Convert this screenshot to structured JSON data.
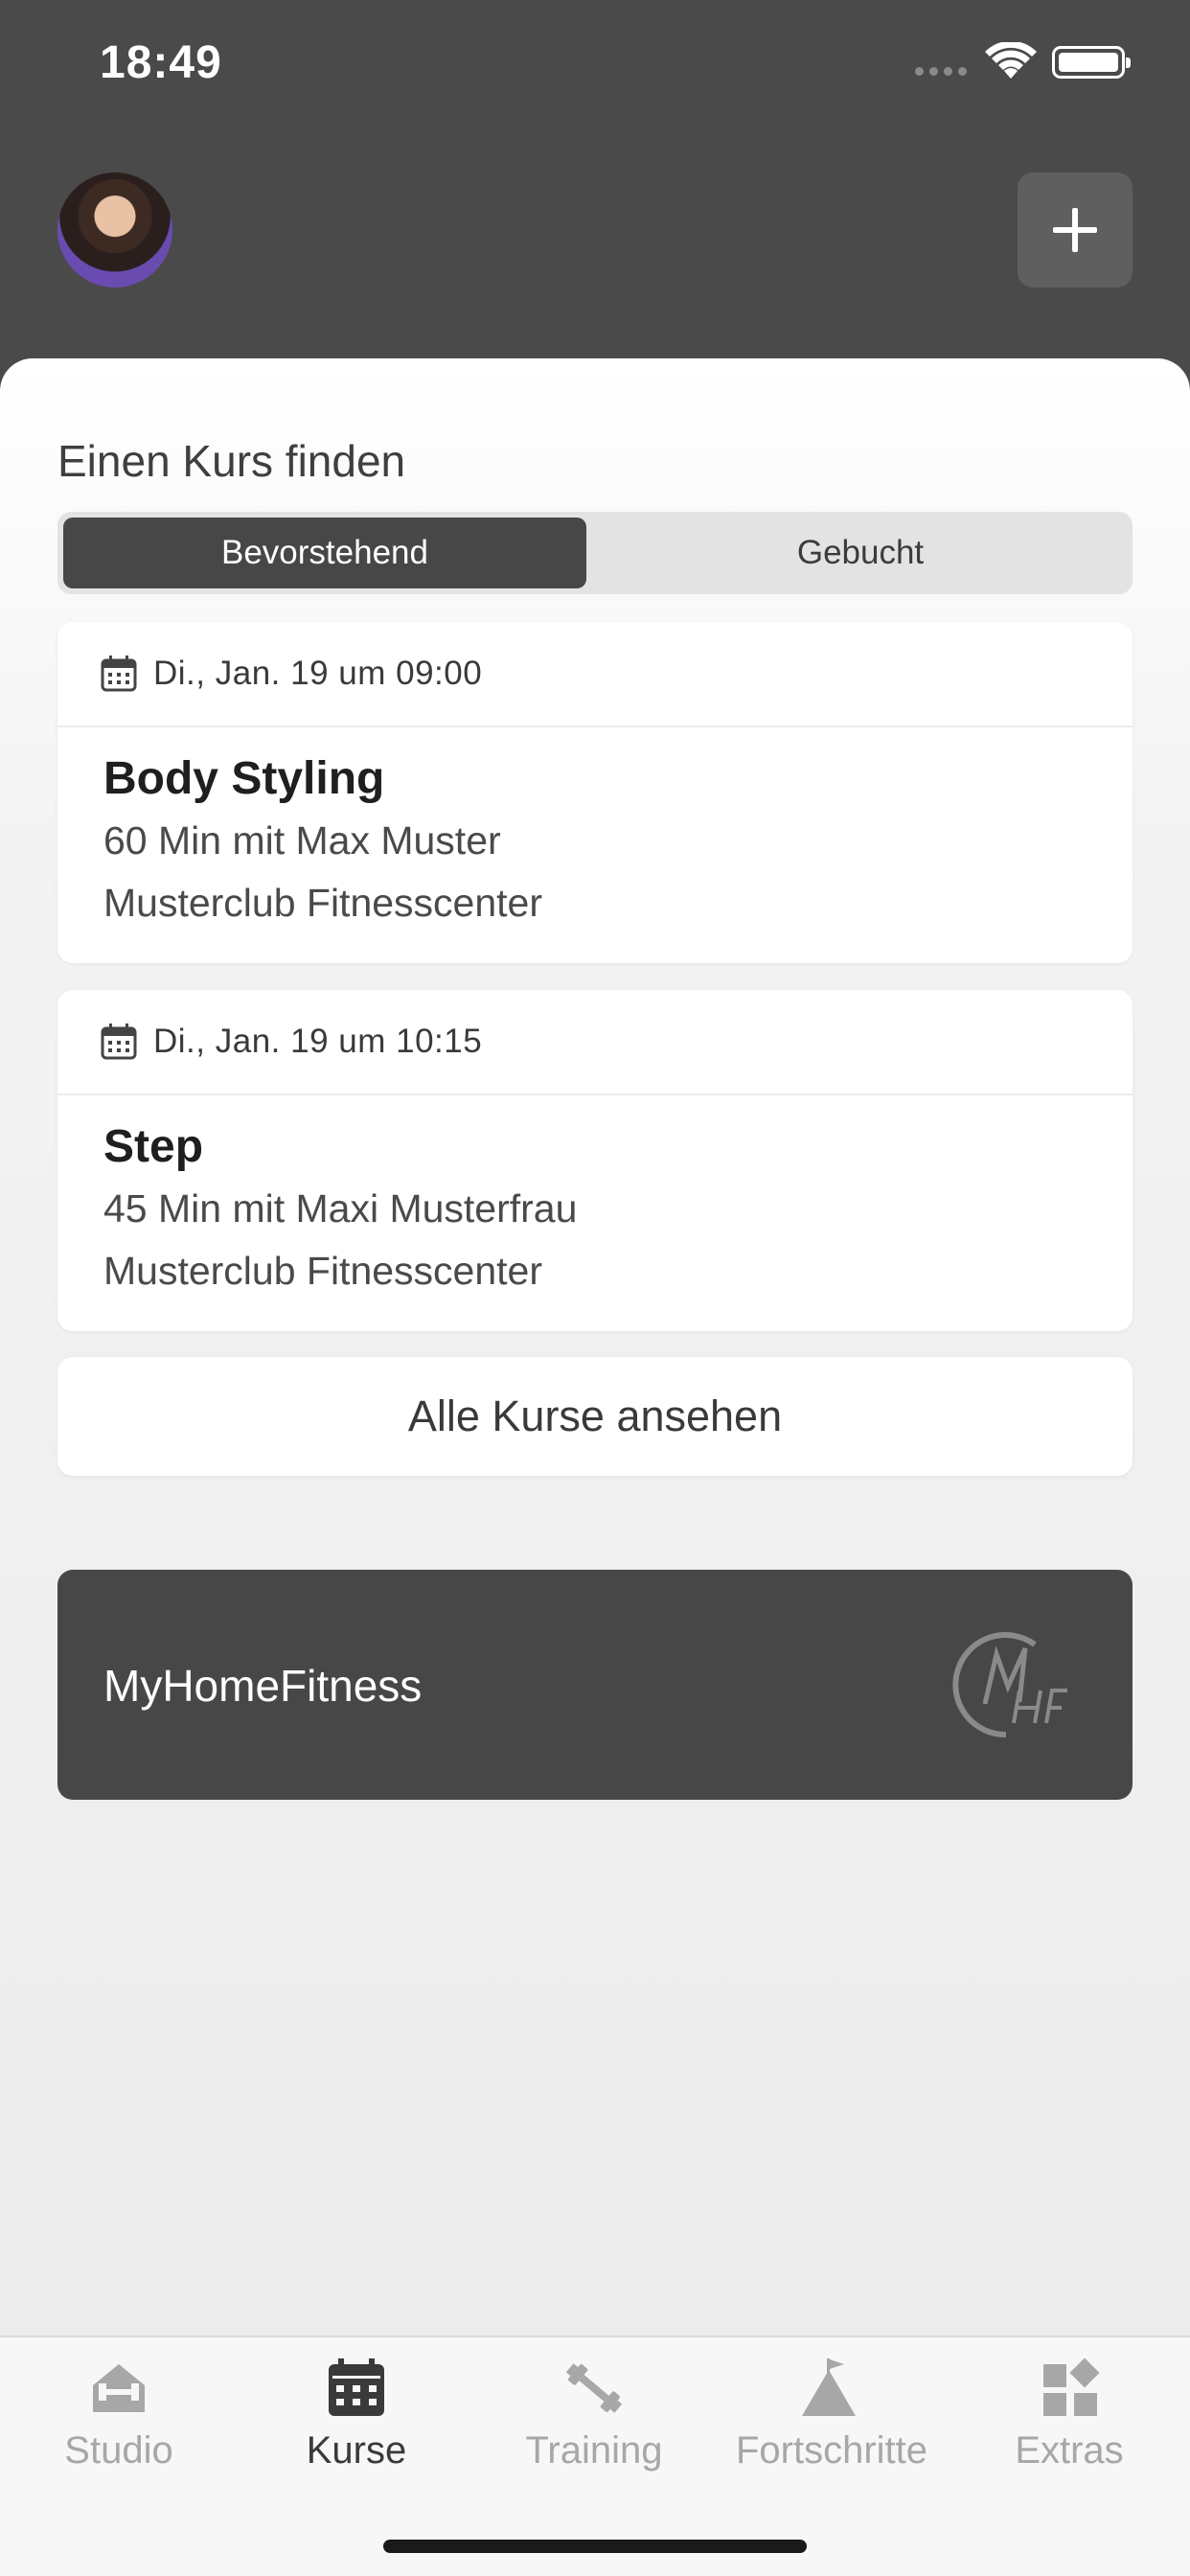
{
  "status_bar": {
    "time": "18:49"
  },
  "header": {
    "add_icon": "plus-icon"
  },
  "colors": {
    "header_bg": "#4a4a4a",
    "active_segment": "#474747",
    "promo_bg": "#474747"
  },
  "section": {
    "title": "Einen Kurs finden"
  },
  "segmented": {
    "upcoming": "Bevorstehend",
    "booked": "Gebucht"
  },
  "courses": [
    {
      "date": "Di., Jan. 19 um 09:00",
      "title": "Body Styling",
      "detail": "60 Min mit Max Muster",
      "location": "Musterclub Fitnesscenter"
    },
    {
      "date": "Di., Jan. 19 um 10:15",
      "title": "Step",
      "detail": "45 Min mit Maxi Musterfrau",
      "location": "Musterclub Fitnesscenter"
    }
  ],
  "all_courses_label": "Alle Kurse ansehen",
  "promo": {
    "label": "MyHomeFitness",
    "logo_icon": "mhf-logo-icon"
  },
  "tabs": [
    {
      "label": "Studio",
      "icon": "studio-icon"
    },
    {
      "label": "Kurse",
      "icon": "calendar-icon"
    },
    {
      "label": "Training",
      "icon": "dumbbell-icon"
    },
    {
      "label": "Fortschritte",
      "icon": "mountain-flag-icon"
    },
    {
      "label": "Extras",
      "icon": "grid-icon"
    }
  ]
}
